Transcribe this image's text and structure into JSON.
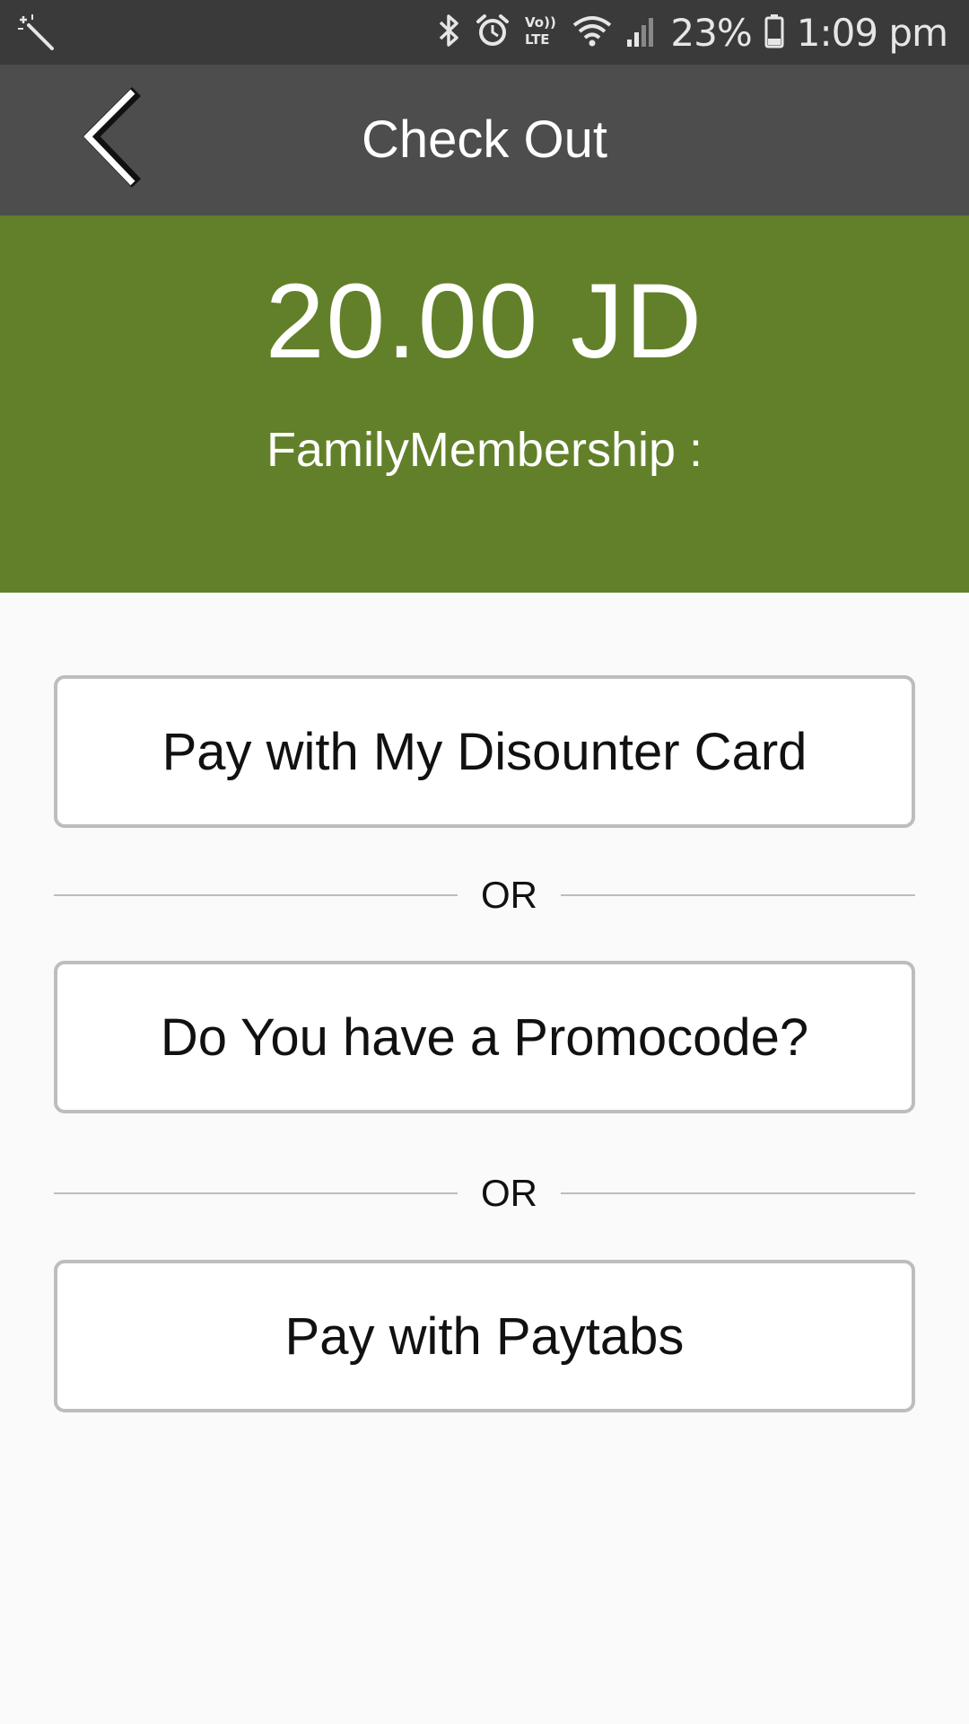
{
  "status_bar": {
    "battery_percent": "23%",
    "time": "1:09 pm",
    "icons": [
      "magic-wand-icon",
      "bluetooth-icon",
      "alarm-icon",
      "volte-icon",
      "wifi-icon",
      "signal-icon",
      "battery-icon"
    ],
    "volte_label": "Vo))\nLTE"
  },
  "app_bar": {
    "title": "Check Out",
    "back_icon": "chevron-left-icon"
  },
  "summary": {
    "amount": "20.00 JD",
    "membership": "FamilyMembership :",
    "background_color": "#628029"
  },
  "options": {
    "discounter_card": "Pay with My Disounter Card",
    "or_1": "OR",
    "promocode": "Do You have a Promocode?",
    "or_2": "OR",
    "paytabs": "Pay with Paytabs"
  }
}
